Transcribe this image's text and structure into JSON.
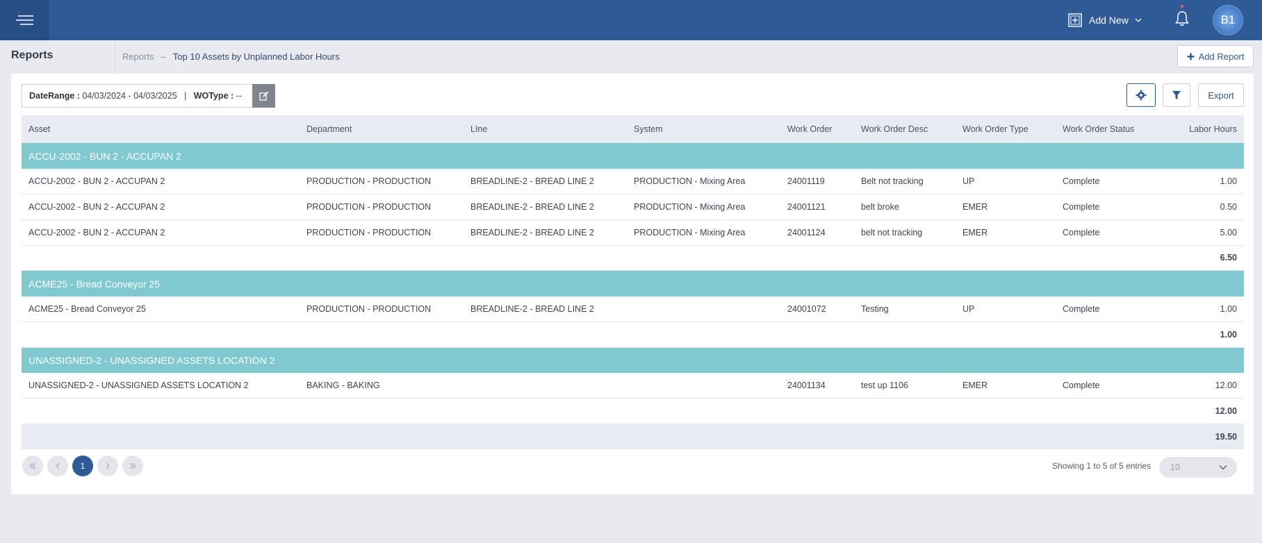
{
  "header": {
    "add_new_label": "Add New",
    "avatar_initials": "B1"
  },
  "page": {
    "title": "Reports",
    "breadcrumb_root": "Reports",
    "breadcrumb_sep": "–",
    "breadcrumb_current": "Top 10 Assets by Unplanned Labor Hours",
    "add_report_label": "Add Report"
  },
  "filters": {
    "date_range_label": "DateRange :",
    "date_range_value": "04/03/2024 - 04/03/2025",
    "separator": "|",
    "wo_type_label": "WOType :",
    "wo_type_value": "--"
  },
  "toolbar": {
    "export_label": "Export"
  },
  "table": {
    "columns": [
      "Asset",
      "Department",
      "LIne",
      "System",
      "Work Order",
      "Work Order Desc",
      "Work Order Type",
      "Work Order Status",
      "Labor Hours"
    ],
    "groups": [
      {
        "name": "ACCU-2002 - BUN 2 - ACCUPAN 2",
        "rows": [
          [
            "ACCU-2002 - BUN 2 - ACCUPAN 2",
            "PRODUCTION - PRODUCTION",
            "BREADLINE-2 - BREAD LINE 2",
            "PRODUCTION - Mixing Area",
            "24001119",
            "Belt not tracking",
            "UP",
            "Complete",
            "1.00"
          ],
          [
            "ACCU-2002 - BUN 2 - ACCUPAN 2",
            "PRODUCTION - PRODUCTION",
            "BREADLINE-2 - BREAD LINE 2",
            "PRODUCTION - Mixing Area",
            "24001121",
            "belt broke",
            "EMER",
            "Complete",
            "0.50"
          ],
          [
            "ACCU-2002 - BUN 2 - ACCUPAN 2",
            "PRODUCTION - PRODUCTION",
            "BREADLINE-2 - BREAD LINE 2",
            "PRODUCTION - Mixing Area",
            "24001124",
            "belt not tracking",
            "EMER",
            "Complete",
            "5.00"
          ]
        ],
        "subtotal": "6.50"
      },
      {
        "name": "ACME25 - Bread Conveyor 25",
        "rows": [
          [
            "ACME25 - Bread Conveyor 25",
            "PRODUCTION - PRODUCTION",
            "BREADLINE-2 - BREAD LINE 2",
            "",
            "24001072",
            "Testing",
            "UP",
            "Complete",
            "1.00"
          ]
        ],
        "subtotal": "1.00"
      },
      {
        "name": "UNASSIGNED-2 - UNASSIGNED ASSETS LOCATION 2",
        "rows": [
          [
            "UNASSIGNED-2 - UNASSIGNED ASSETS LOCATION 2",
            "BAKING - BAKING",
            "",
            "",
            "24001134",
            "test up 1106",
            "EMER",
            "Complete",
            "12.00"
          ]
        ],
        "subtotal": "12.00"
      }
    ],
    "grand_total": "19.50"
  },
  "pagination": {
    "current_page": "1",
    "showing_text": "Showing 1 to 5 of 5 entries",
    "page_size": "10"
  },
  "colors": {
    "topbar": "#2e5a96",
    "group_row": "#80c9d1",
    "header_row": "#e9ebf3"
  }
}
